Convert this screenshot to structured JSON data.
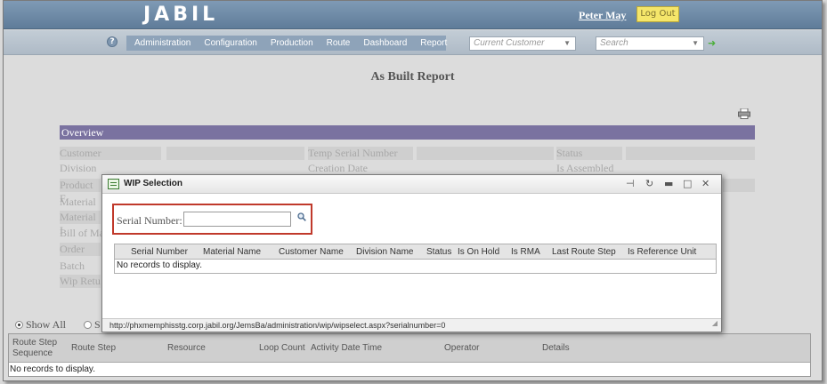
{
  "header": {
    "logo": "JABIL",
    "user_name": "Peter May",
    "logout_label": "Log Out"
  },
  "nav": {
    "items": [
      "Administration",
      "Configuration",
      "Production",
      "Route",
      "Dashboard",
      "Report"
    ],
    "customer_select": "Current Customer",
    "search_select": "Search"
  },
  "page": {
    "title": "As Built Report",
    "overview_title": "Overview",
    "overview_labels": {
      "customer": "Customer",
      "division": "Division",
      "product": "Product F",
      "material": "Material",
      "material2": "Material I",
      "bom": "Bill of Ma",
      "order": "Order",
      "batch": "Batch",
      "wip": "Wip Retu",
      "temp_serial": "Temp Serial Number",
      "creation_date": "Creation Date",
      "status": "Status",
      "is_assembled": "Is Assembled"
    },
    "filter": {
      "show_all": "Show All",
      "second": "S"
    },
    "route_table": {
      "columns": [
        "Route Step Sequence",
        "Route Step",
        "Resource",
        "Loop Count",
        "Activity Date Time",
        "Operator",
        "Details"
      ],
      "empty": "No records to display."
    }
  },
  "modal": {
    "title": "WIP Selection",
    "serial_label": "Serial Number:",
    "serial_value": "",
    "columns": [
      "Serial Number",
      "Material Name",
      "Customer Name",
      "Division Name",
      "Status",
      "Is On Hold",
      "Is RMA",
      "Last Route Step",
      "Is Reference Unit"
    ],
    "empty": "No records to display.",
    "status_url": "http://phxmemphisstg.corp.jabil.org/JemsBa/administration/wip/wipselect.aspx?serialnumber=0"
  },
  "colors": {
    "header": "#6b87a3",
    "overview": "#7a72a0",
    "highlight_border": "#c0392b",
    "logout": "#f5e66a"
  }
}
